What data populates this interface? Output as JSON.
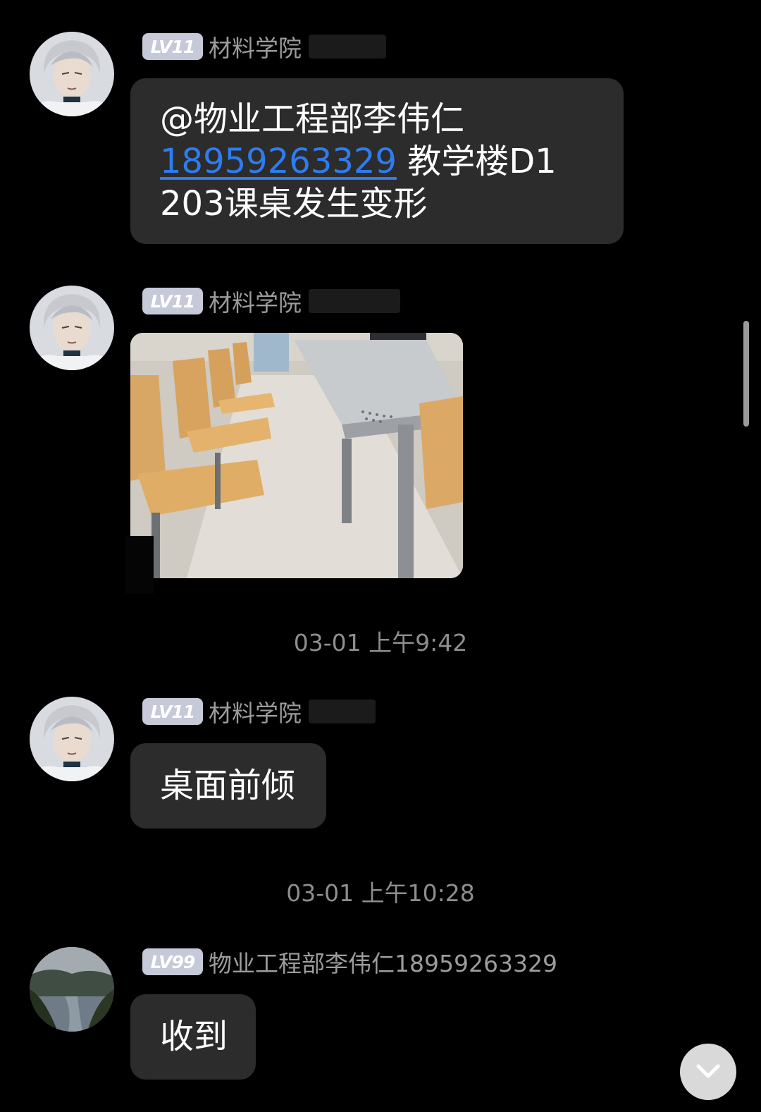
{
  "messages": [
    {
      "level_badge": "LV11",
      "sender": "材料学院",
      "text_line1": "@物业工程部李伟仁",
      "phone": "18959263329",
      "text_after_phone": " 教学楼D1",
      "text_line3": "203课桌发生变形"
    },
    {
      "level_badge": "LV11",
      "sender": "材料学院"
    },
    {
      "level_badge": "LV11",
      "sender": "材料学院",
      "text": "桌面前倾"
    },
    {
      "level_badge": "LV99",
      "sender": "物业工程部李伟仁18959263329",
      "text": "收到"
    }
  ],
  "timestamps": [
    "03-01 上午9:42",
    "03-01 上午10:28"
  ],
  "icons": {
    "scroll_down": "chevron-down-icon"
  },
  "colors": {
    "background": "#000000",
    "bubble": "#2c2c2c",
    "link": "#2f7cf0",
    "badge": "#c5c9d8"
  }
}
